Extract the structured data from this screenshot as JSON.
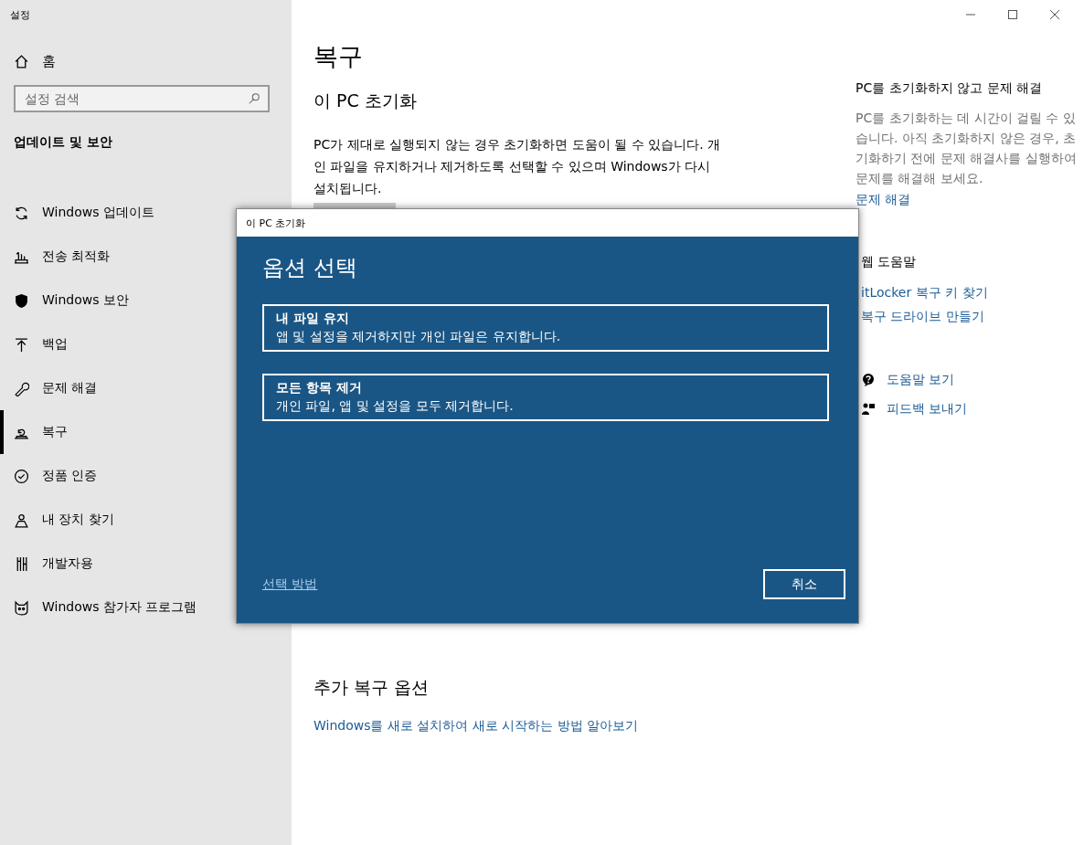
{
  "window": {
    "title": "설정"
  },
  "sidebar": {
    "home": "홈",
    "search": {
      "placeholder": "설정 검색"
    },
    "section": "업데이트 및 보안",
    "items": [
      {
        "label": "Windows 업데이트",
        "kind": "sync",
        "selected": false
      },
      {
        "label": "전송 최적화",
        "kind": "delivery",
        "selected": false
      },
      {
        "label": "Windows 보안",
        "kind": "shield",
        "selected": false
      },
      {
        "label": "백업",
        "kind": "backup",
        "selected": false
      },
      {
        "label": "문제 해결",
        "kind": "wrench",
        "selected": false
      },
      {
        "label": "복구",
        "kind": "recovery",
        "selected": true
      },
      {
        "label": "정품 인증",
        "kind": "check",
        "selected": false
      },
      {
        "label": "내 장치 찾기",
        "kind": "person",
        "selected": false
      },
      {
        "label": "개발자용",
        "kind": "tools",
        "selected": false
      },
      {
        "label": "Windows 참가자 프로그램",
        "kind": "cat",
        "selected": false
      }
    ]
  },
  "main": {
    "title": "복구",
    "section": "이 PC 초기화",
    "description": "PC가 제대로 실행되지 않는 경우 초기화하면 도움이 될 수 있습니다. 개인 파일을 유지하거나 제거하도록 선택할 수 있으며 Windows가 다시 설치됩니다.",
    "more_title": "추가 복구 옵션",
    "more_link": "Windows를 새로 설치하여 새로 시작하는 방법 알아보기"
  },
  "aside": {
    "title": "PC를 초기화하지 않고 문제 해결",
    "text": "PC를 초기화하는 데 시간이 걸릴 수 있습니다. 아직 초기화하지 않은 경우, 초기화하기 전에 문제 해결사를 실행하여 문제를 해결해 보세요.",
    "link": "문제 해결",
    "web_title": "웹 도움말",
    "web_links": [
      "itLocker 복구 키 찾기",
      "복구 드라이브 만들기"
    ],
    "actions": [
      {
        "label": "도움말 보기",
        "kind": "help"
      },
      {
        "label": "피드백 보내기",
        "kind": "feedback"
      }
    ]
  },
  "dialog": {
    "title": "이 PC 초기화",
    "heading": "옵션 선택",
    "options": [
      {
        "title": "내 파일 유지",
        "text": "앱 및 설정을 제거하지만 개인 파일은 유지합니다."
      },
      {
        "title": "모든 항목 제거",
        "text": "개인 파일, 앱 및 설정을 모두 제거합니다."
      }
    ],
    "help_link": "선택 방법",
    "cancel": "취소"
  }
}
